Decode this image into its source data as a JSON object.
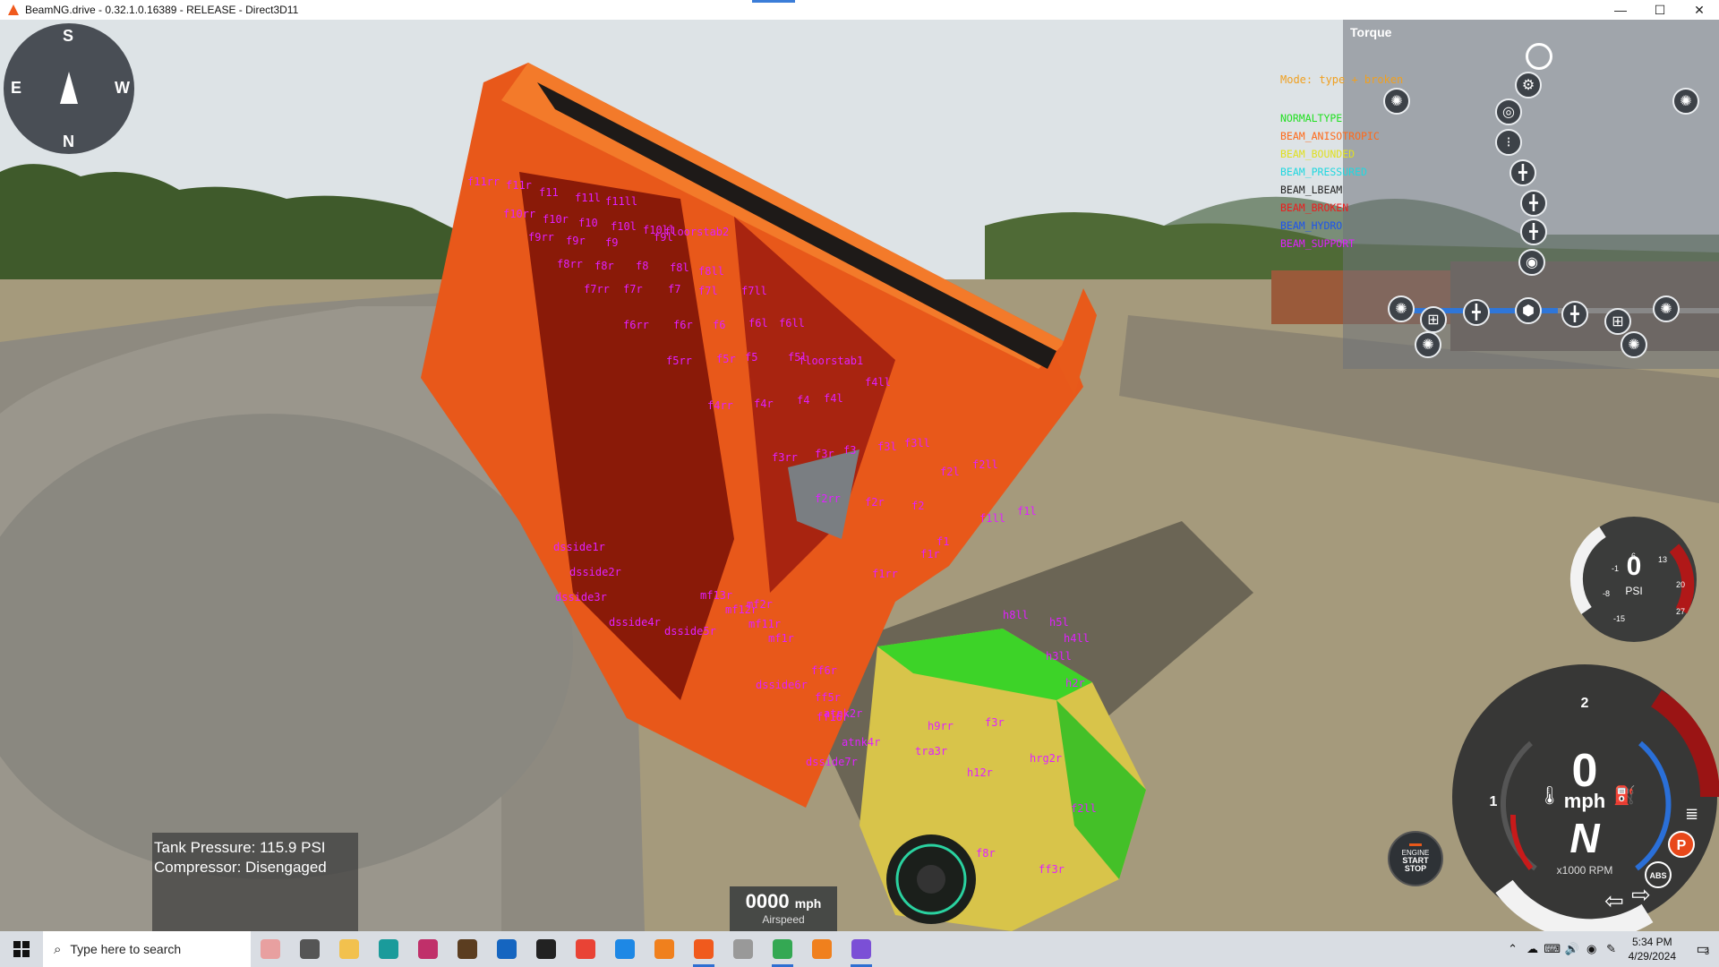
{
  "window": {
    "title": "BeamNG.drive - 0.32.1.0.16389 - RELEASE - Direct3D11",
    "minimize_icon": "minimize-icon",
    "maximize_icon": "maximize-icon",
    "close_icon": "close-icon"
  },
  "compass": {
    "north": "N",
    "south": "S",
    "east": "E",
    "west": "W"
  },
  "torque_panel": {
    "title": "Torque",
    "mode": "Mode: type + broken",
    "legend": [
      {
        "label": "NORMALTYPE",
        "color": "#22e022"
      },
      {
        "label": "BEAM_ANISOTROPIC",
        "color": "#ff6a1a"
      },
      {
        "label": "BEAM_BOUNDED",
        "color": "#e0e020"
      },
      {
        "label": "BEAM_PRESSURED",
        "color": "#20d8e0"
      },
      {
        "label": "BEAM_LBEAM",
        "color": "#222222"
      },
      {
        "label": "BEAM_BROKEN",
        "color": "#ee1c1c"
      },
      {
        "label": "BEAM_HYDRO",
        "color": "#1c54ee"
      },
      {
        "label": "BEAM_SUPPORT",
        "color": "#e020ff"
      }
    ]
  },
  "beam_labels": [
    "f11rr",
    "f11r",
    "f11",
    "f11l",
    "f11ll",
    "f10rr",
    "f10r",
    "f10",
    "f10l",
    "f10ll",
    "f9rr",
    "f9r",
    "f9",
    "f9l",
    "floorstab2",
    "f8rr",
    "f8r",
    "f8",
    "f8l",
    "f8ll",
    "f7rr",
    "f7r",
    "f7",
    "f7l",
    "f7ll",
    "f6rr",
    "f6r",
    "f6",
    "f6l",
    "f6ll",
    "f5rr",
    "f5r",
    "f5",
    "f5l",
    "floorstab1",
    "f4rr",
    "f4r",
    "f4",
    "f4l",
    "f4ll",
    "f3rr",
    "f3r",
    "f3",
    "f3l",
    "f3ll",
    "f2rr",
    "f2r",
    "f2",
    "f2l",
    "f2ll",
    "f1ll",
    "f1l",
    "f1",
    "f1r",
    "f1rr",
    "dsside1r",
    "dsside2r",
    "dsside3r",
    "dsside4r",
    "dsside5r",
    "dsside6r",
    "dsside7r",
    "mf13r",
    "mf12r",
    "mf11r",
    "mf2r",
    "mf1r",
    "ff6r",
    "ff5r",
    "ff16r",
    "atnk2r",
    "atnk4r",
    "h9rr",
    "h8ll",
    "h5l",
    "h4ll",
    "h3ll",
    "h2r",
    "h12r",
    "hrg2r",
    "f2ll",
    "ff3r",
    "f8r",
    "f3r",
    "tra3r"
  ],
  "tank": {
    "pressure": "Tank Pressure: 115.9 PSI",
    "compressor": "Compressor: Disengaged"
  },
  "airspeed": {
    "value": "0000",
    "unit": "mph",
    "label": "Airspeed"
  },
  "boost_gauge": {
    "value": "0",
    "unit": "PSI",
    "ticks": [
      "-15",
      "-8",
      "-1",
      "6",
      "13",
      "20",
      "27"
    ]
  },
  "main_gauge": {
    "speed": "0",
    "speed_unit": "mph",
    "gear": "N",
    "rpm_label": "x1000 RPM",
    "rpm_ticks": [
      "1",
      "2"
    ],
    "parking": "P",
    "abs": "ABS"
  },
  "engine_button": {
    "line1": "ENGINE",
    "line2": "START",
    "line3": "STOP"
  },
  "taskbar": {
    "search_placeholder": "Type here to search",
    "time": "5:34 PM",
    "date": "4/29/2024",
    "notifications": "3",
    "apps": [
      {
        "name": "widgets-icon",
        "color": "#e8a0a0"
      },
      {
        "name": "task-view-icon",
        "color": "#555"
      },
      {
        "name": "file-explorer-icon",
        "color": "#f2c14e"
      },
      {
        "name": "arduino-icon",
        "color": "#1a9b9b"
      },
      {
        "name": "app-icon-spiral",
        "color": "#c0306a"
      },
      {
        "name": "minecraft-icon",
        "color": "#5b3d20"
      },
      {
        "name": "outlook-icon",
        "color": "#1565c0"
      },
      {
        "name": "app-icon-dark",
        "color": "#222"
      },
      {
        "name": "chrome-icon",
        "color": "#e94335"
      },
      {
        "name": "app-icon-c",
        "color": "#1e88e5"
      },
      {
        "name": "blender-icon",
        "color": "#f0801d"
      },
      {
        "name": "beamng-icon",
        "color": "#f05a1d",
        "active": true
      },
      {
        "name": "app-icon-line",
        "color": "#999"
      },
      {
        "name": "chrome-profile-icon",
        "color": "#34a853",
        "active": true
      },
      {
        "name": "blender-icon-2",
        "color": "#f0801d"
      },
      {
        "name": "visual-studio-icon",
        "color": "#7b4fd6",
        "active": true
      }
    ]
  }
}
